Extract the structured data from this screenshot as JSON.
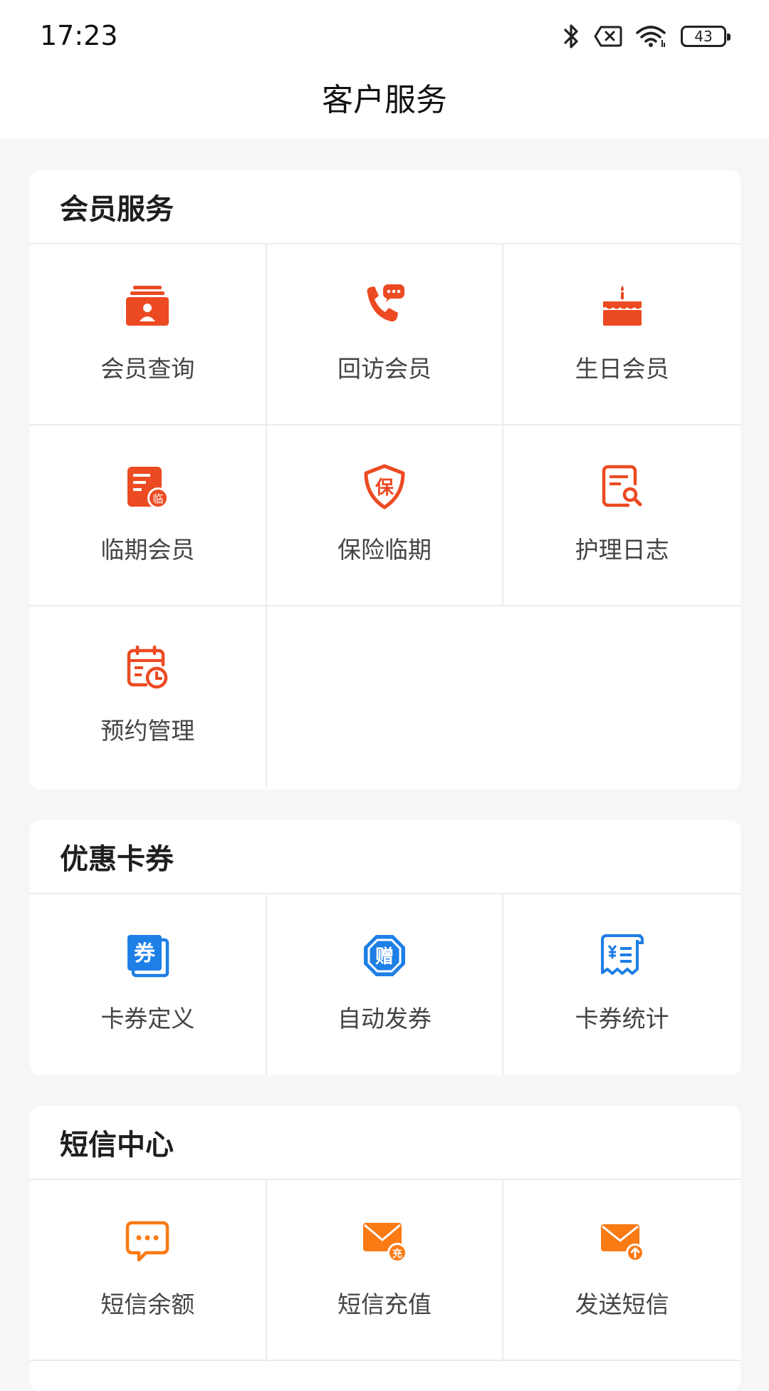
{
  "status_bar": {
    "time": "17:23",
    "battery": "43"
  },
  "header": {
    "title": "客户服务"
  },
  "sections": [
    {
      "title": "会员服务",
      "items": [
        {
          "label": "会员查询",
          "icon": "member-card-icon"
        },
        {
          "label": "回访会员",
          "icon": "phone-chat-icon"
        },
        {
          "label": "生日会员",
          "icon": "birthday-cake-icon"
        },
        {
          "label": "临期会员",
          "icon": "expiring-doc-icon"
        },
        {
          "label": "保险临期",
          "icon": "insurance-shield-icon"
        },
        {
          "label": "护理日志",
          "icon": "log-search-icon"
        },
        {
          "label": "预约管理",
          "icon": "calendar-clock-icon"
        }
      ]
    },
    {
      "title": "优惠卡券",
      "items": [
        {
          "label": "卡券定义",
          "icon": "coupon-icon"
        },
        {
          "label": "自动发券",
          "icon": "gift-coupon-icon"
        },
        {
          "label": "卡券统计",
          "icon": "receipt-icon"
        }
      ]
    },
    {
      "title": "短信中心",
      "items": [
        {
          "label": "短信余额",
          "icon": "sms-bubble-icon"
        },
        {
          "label": "短信充值",
          "icon": "mail-recharge-icon"
        },
        {
          "label": "发送短信",
          "icon": "mail-send-icon"
        }
      ]
    }
  ],
  "icon_glyphs": {
    "insurance": "保",
    "coupon": "券",
    "gift": "赠",
    "recharge": "充",
    "expiring": "临"
  },
  "colors": {
    "red": "#ec4a22",
    "blue": "#1e7fe6",
    "orange": "#fa7a14"
  }
}
